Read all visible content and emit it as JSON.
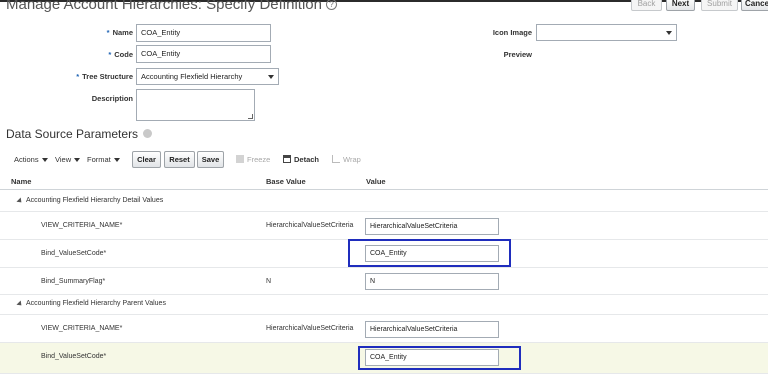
{
  "page": {
    "title": "Manage Account Hierarchies: Specify Definition",
    "help_glyph": "?",
    "buttons": {
      "back": "Back",
      "next": "Next",
      "submit": "Submit",
      "cancel": "Cancel"
    }
  },
  "form": {
    "name_label": "Name",
    "name_value": "COA_Entity",
    "code_label": "Code",
    "code_value": "COA_Entity",
    "tree_structure_label": "Tree Structure",
    "tree_structure_value": "Accounting Flexfield Hierarchy",
    "description_label": "Description",
    "description_value": "",
    "icon_image_label": "Icon Image",
    "icon_image_value": "",
    "preview_label": "Preview",
    "required_marker": "*"
  },
  "section": {
    "title": "Data Source Parameters"
  },
  "toolbar": {
    "actions": "Actions",
    "view": "View",
    "format": "Format",
    "clear": "Clear",
    "reset": "Reset",
    "save": "Save",
    "freeze": "Freeze",
    "detach": "Detach",
    "wrap": "Wrap"
  },
  "table": {
    "columns": [
      "Name",
      "Base Value",
      "Value"
    ],
    "groups": [
      {
        "label": "Accounting Flexfield Hierarchy Detail Values",
        "rows": [
          {
            "name": "VIEW_CRITERIA_NAME*",
            "base": "HierarchicalValueSetCriteria",
            "value": "HierarchicalValueSetCriteria"
          },
          {
            "name": "Bind_ValueSetCode*",
            "base": "",
            "value": "COA_Entity"
          },
          {
            "name": "Bind_SummaryFlag*",
            "base": "N",
            "value": "N"
          }
        ]
      },
      {
        "label": "Accounting Flexfield Hierarchy Parent Values",
        "rows": [
          {
            "name": "VIEW_CRITERIA_NAME*",
            "base": "HierarchicalValueSetCriteria",
            "value": "HierarchicalValueSetCriteria"
          },
          {
            "name": "Bind_ValueSetCode*",
            "base": "",
            "value": "COA_Entity"
          }
        ]
      }
    ]
  },
  "colors": {
    "highlight": "#1f2dbd",
    "selected_row": "#f6f8e6",
    "required_marker": "#1e63b4"
  },
  "icons": [
    "help-icon",
    "dropdown-arrow-icon",
    "resize-grip-icon",
    "collapse-triangle-icon",
    "freeze-icon",
    "detach-icon",
    "wrap-icon"
  ]
}
